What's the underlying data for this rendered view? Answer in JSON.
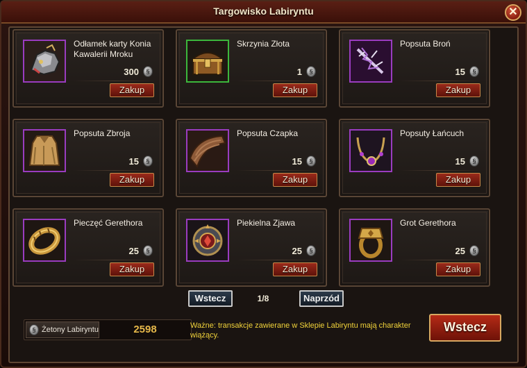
{
  "window": {
    "title": "Targowisko Labiryntu",
    "close_icon": "✕"
  },
  "items": [
    {
      "name": "Odłamek karty Konia Kawalerii Mroku",
      "price": "300",
      "buy_label": "Zakup",
      "icon": "horse-armor-icon",
      "rarity_color": "#9a3cc0"
    },
    {
      "name": "Skrzynia Złota",
      "price": "1",
      "buy_label": "Zakup",
      "icon": "treasure-chest-icon",
      "rarity_color": "#3cb83c"
    },
    {
      "name": "Popsuta Broń",
      "price": "15",
      "buy_label": "Zakup",
      "icon": "broken-weapon-icon",
      "rarity_color": "#9a3cc0"
    },
    {
      "name": "Popsuta Zbroja",
      "price": "15",
      "buy_label": "Zakup",
      "icon": "cloak-armor-icon",
      "rarity_color": "#9a3cc0"
    },
    {
      "name": "Popsuta Czapka",
      "price": "15",
      "buy_label": "Zakup",
      "icon": "cap-icon",
      "rarity_color": "#9a3cc0"
    },
    {
      "name": "Popsuty Łańcuch",
      "price": "15",
      "buy_label": "Zakup",
      "icon": "necklace-icon",
      "rarity_color": "#9a3cc0"
    },
    {
      "name": "Pieczęć Gerethora",
      "price": "25",
      "buy_label": "Zakup",
      "icon": "gold-ring-icon",
      "rarity_color": "#9a3cc0"
    },
    {
      "name": "Piekielna Zjawa",
      "price": "25",
      "buy_label": "Zakup",
      "icon": "hell-emblem-icon",
      "rarity_color": "#9a3cc0"
    },
    {
      "name": "Grot Gerethora",
      "price": "25",
      "buy_label": "Zakup",
      "icon": "signet-ring-icon",
      "rarity_color": "#9a3cc0"
    }
  ],
  "pagination": {
    "prev_label": "Wstecz",
    "page": "1/8",
    "next_label": "Naprzód"
  },
  "tokens": {
    "label": "Żetony Labiryntu",
    "value": "2598",
    "icon": "token-coin-icon"
  },
  "notice": "Ważne: transakcje zawierane w Sklepie Labiryntu mają charakter wiążący.",
  "back_button": "Wstecz"
}
